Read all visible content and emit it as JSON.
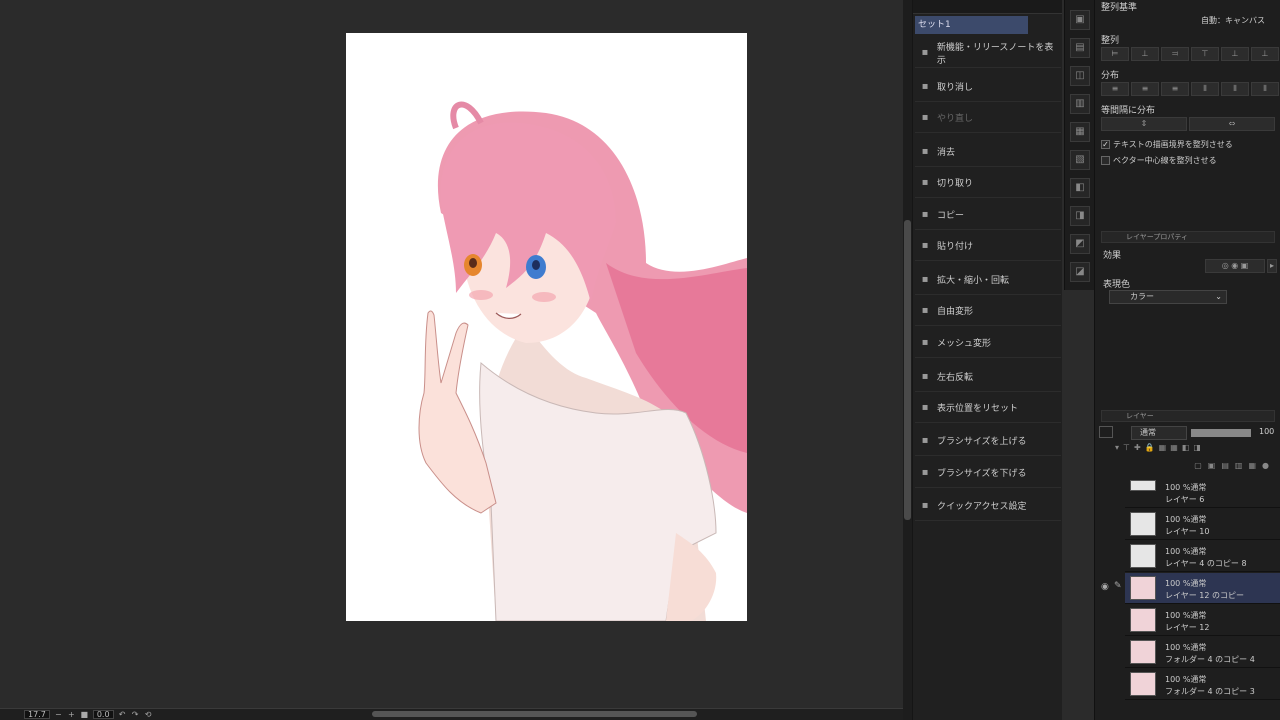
{
  "quick_access": {
    "set_label": "セット1",
    "items": [
      {
        "label": "新機能・リリースノートを表示",
        "icon": "monitor-icon",
        "disabled": false
      },
      {
        "label": "取り消し",
        "icon": "undo-icon",
        "disabled": false
      },
      {
        "label": "やり直し",
        "icon": "redo-icon",
        "disabled": true
      },
      {
        "label": "消去",
        "icon": "erase-icon",
        "disabled": false
      },
      {
        "label": "切り取り",
        "icon": "scissors-icon",
        "disabled": false
      },
      {
        "label": "コピー",
        "icon": "copy-icon",
        "disabled": false
      },
      {
        "label": "貼り付け",
        "icon": "paste-icon",
        "disabled": false
      },
      {
        "label": "拡大・縮小・回転",
        "icon": "transform-icon",
        "disabled": false
      },
      {
        "label": "自由変形",
        "icon": "free-transform-icon",
        "disabled": false
      },
      {
        "label": "メッシュ変形",
        "icon": "mesh-transform-icon",
        "disabled": false
      },
      {
        "label": "左右反転",
        "icon": "flip-horizontal-icon",
        "disabled": false
      },
      {
        "label": "表示位置をリセット",
        "icon": "reset-position-icon",
        "disabled": false
      },
      {
        "label": "ブラシサイズを上げる",
        "icon": "brush-size-up-icon",
        "disabled": false
      },
      {
        "label": "ブラシサイズを下げる",
        "icon": "brush-size-down-icon",
        "disabled": false
      },
      {
        "label": "クイックアクセス設定",
        "icon": "settings-icon",
        "disabled": false
      }
    ]
  },
  "align_panel": {
    "header": "整列基準",
    "basis_value": "自動：キャンバス",
    "align_label": "整列",
    "distribute_label": "分布",
    "equal_spacing_label": "等間隔に分布",
    "check_text_bounds": "テキストの描画境界を整列させる",
    "check_text_bounds_checked": true,
    "check_vector_center": "ベクター中心線を整列させる",
    "check_vector_center_checked": false
  },
  "layer_property": {
    "header": "レイヤープロパティ",
    "effect_label": "効果",
    "expression_color_label": "表現色",
    "expression_color_value": "カラー"
  },
  "layer_panel": {
    "header": "レイヤー",
    "blend_mode": "通常",
    "opacity": "100",
    "layers": [
      {
        "line1": "100 %通常",
        "line2": "レイヤー 6",
        "selected": false,
        "visible": false
      },
      {
        "line1": "100 %通常",
        "line2": "レイヤー 10",
        "selected": false,
        "visible": false
      },
      {
        "line1": "100 %通常",
        "line2": "レイヤー 4 のコピー 8",
        "selected": false,
        "visible": false
      },
      {
        "line1": "100 %通常",
        "line2": "レイヤー 12 のコピー",
        "selected": true,
        "visible": true
      },
      {
        "line1": "100 %通常",
        "line2": "レイヤー 12",
        "selected": false,
        "visible": false
      },
      {
        "line1": "100 %通常",
        "line2": "フォルダー 4 のコピー 4",
        "selected": false,
        "visible": false
      },
      {
        "line1": "100 %通常",
        "line2": "フォルダー 4 のコピー 3",
        "selected": false,
        "visible": false
      }
    ]
  },
  "status_bar": {
    "zoom": "17.7",
    "angle": "0.0"
  }
}
